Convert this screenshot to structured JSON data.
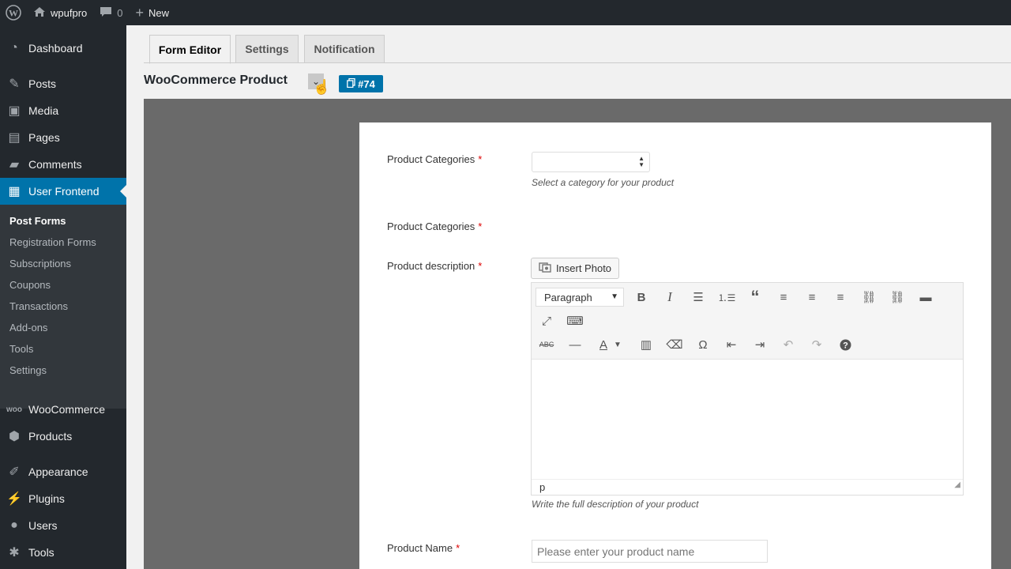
{
  "adminbar": {
    "site_name": "wpufpro",
    "comments_count": "0",
    "new_label": "New"
  },
  "sidebar": {
    "items": [
      {
        "label": "Dashboard",
        "icon": "dashboard-icon"
      },
      {
        "label": "Posts",
        "icon": "pin-icon"
      },
      {
        "label": "Media",
        "icon": "media-icon"
      },
      {
        "label": "Pages",
        "icon": "pages-icon"
      },
      {
        "label": "Comments",
        "icon": "comments-icon"
      },
      {
        "label": "User Frontend",
        "icon": "layout-icon"
      },
      {
        "label": "WooCommerce",
        "icon": "woo-icon"
      },
      {
        "label": "Products",
        "icon": "products-icon"
      },
      {
        "label": "Appearance",
        "icon": "brush-icon"
      },
      {
        "label": "Plugins",
        "icon": "plug-icon"
      },
      {
        "label": "Users",
        "icon": "user-icon"
      },
      {
        "label": "Tools",
        "icon": "wrench-icon"
      }
    ],
    "submenu": [
      "Post Forms",
      "Registration Forms",
      "Subscriptions",
      "Coupons",
      "Transactions",
      "Add-ons",
      "Tools",
      "Settings"
    ]
  },
  "tabs": [
    "Form Editor",
    "Settings",
    "Notification"
  ],
  "form": {
    "title": "WooCommerce Product",
    "id_label": "#74"
  },
  "fields": {
    "categories_label": "Product Categories",
    "categories_help": "Select a category for your product",
    "categories2_label": "Product Categories",
    "description_label": "Product description",
    "insert_photo": "Insert Photo",
    "format_value": "Paragraph",
    "status_path": "p",
    "description_help": "Write the full description of your product",
    "name_label": "Product Name",
    "name_placeholder": "Please enter your product name",
    "required_mark": "*"
  },
  "colors": {
    "accent": "#0073aa",
    "admin_bg": "#23282d",
    "canvas": "#6a6a6a"
  }
}
